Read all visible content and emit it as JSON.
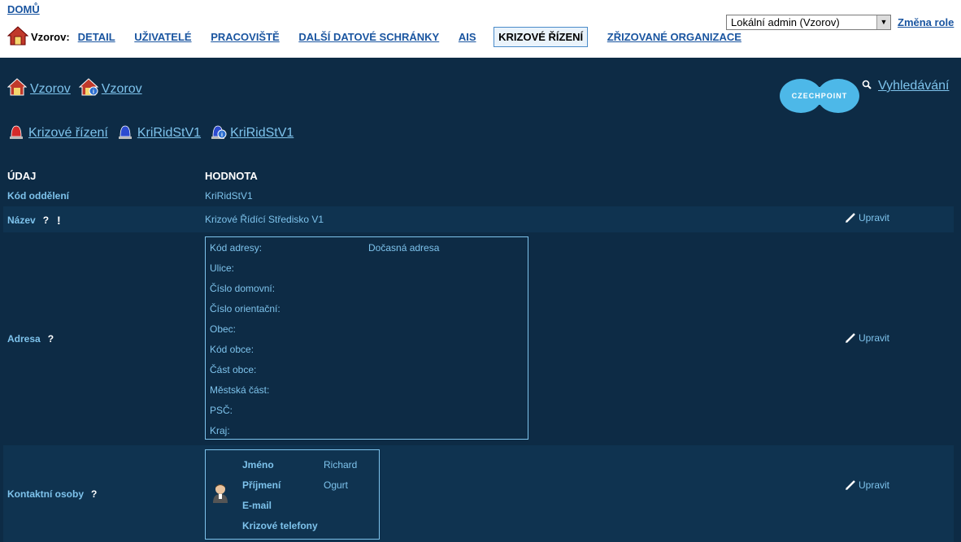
{
  "top": {
    "home_link": "DOMŮ",
    "org_label": "Vzorov:",
    "nav": [
      "DETAIL",
      "UŽIVATELÉ",
      "PRACOVIŠTĚ",
      "DALŠÍ DATOVÉ SCHRÁNKY",
      "AIS",
      "KRIZOVÉ ŘÍZENÍ",
      "ZŘIZOVANÉ ORGANIZACE"
    ],
    "active_nav": "KRIZOVÉ ŘÍZENÍ",
    "role_select_value": "Lokální admin (Vzorov)",
    "role_change": "Změna role"
  },
  "breadcrumbs1": [
    "Vzorov",
    "Vzorov"
  ],
  "breadcrumbs2": [
    "Krizové řízení",
    "KriRidStV1",
    "KriRidStV1"
  ],
  "logo_text": "CZECHPOINT",
  "search_link": "Vyhledávání",
  "table": {
    "col_udaj": "ÚDAJ",
    "col_hodnota": "HODNOTA",
    "kod_label": "Kód oddělení",
    "kod_value": "KriRidStV1",
    "nazev_label": "Název",
    "nazev_value": "Krizové Řídící Středisko V1",
    "adresa_label": "Adresa",
    "kontakt_label": "Kontaktní osoby",
    "help": "?",
    "required": "!",
    "edit": "Upravit"
  },
  "address": [
    {
      "label": "Kód adresy:",
      "value": "Dočasná adresa"
    },
    {
      "label": "Ulice:",
      "value": ""
    },
    {
      "label": "Číslo domovní:",
      "value": ""
    },
    {
      "label": "Číslo orientační:",
      "value": ""
    },
    {
      "label": "Obec:",
      "value": ""
    },
    {
      "label": "Kód obce:",
      "value": ""
    },
    {
      "label": "Část obce:",
      "value": ""
    },
    {
      "label": "Městská část:",
      "value": ""
    },
    {
      "label": "PSČ:",
      "value": ""
    },
    {
      "label": "Kraj:",
      "value": ""
    }
  ],
  "contact": [
    {
      "label": "Jméno",
      "value": "Richard"
    },
    {
      "label": "Příjmení",
      "value": "Ogurt"
    },
    {
      "label": "E-mail",
      "value": ""
    },
    {
      "label": "Krizové telefony",
      "value": ""
    }
  ]
}
